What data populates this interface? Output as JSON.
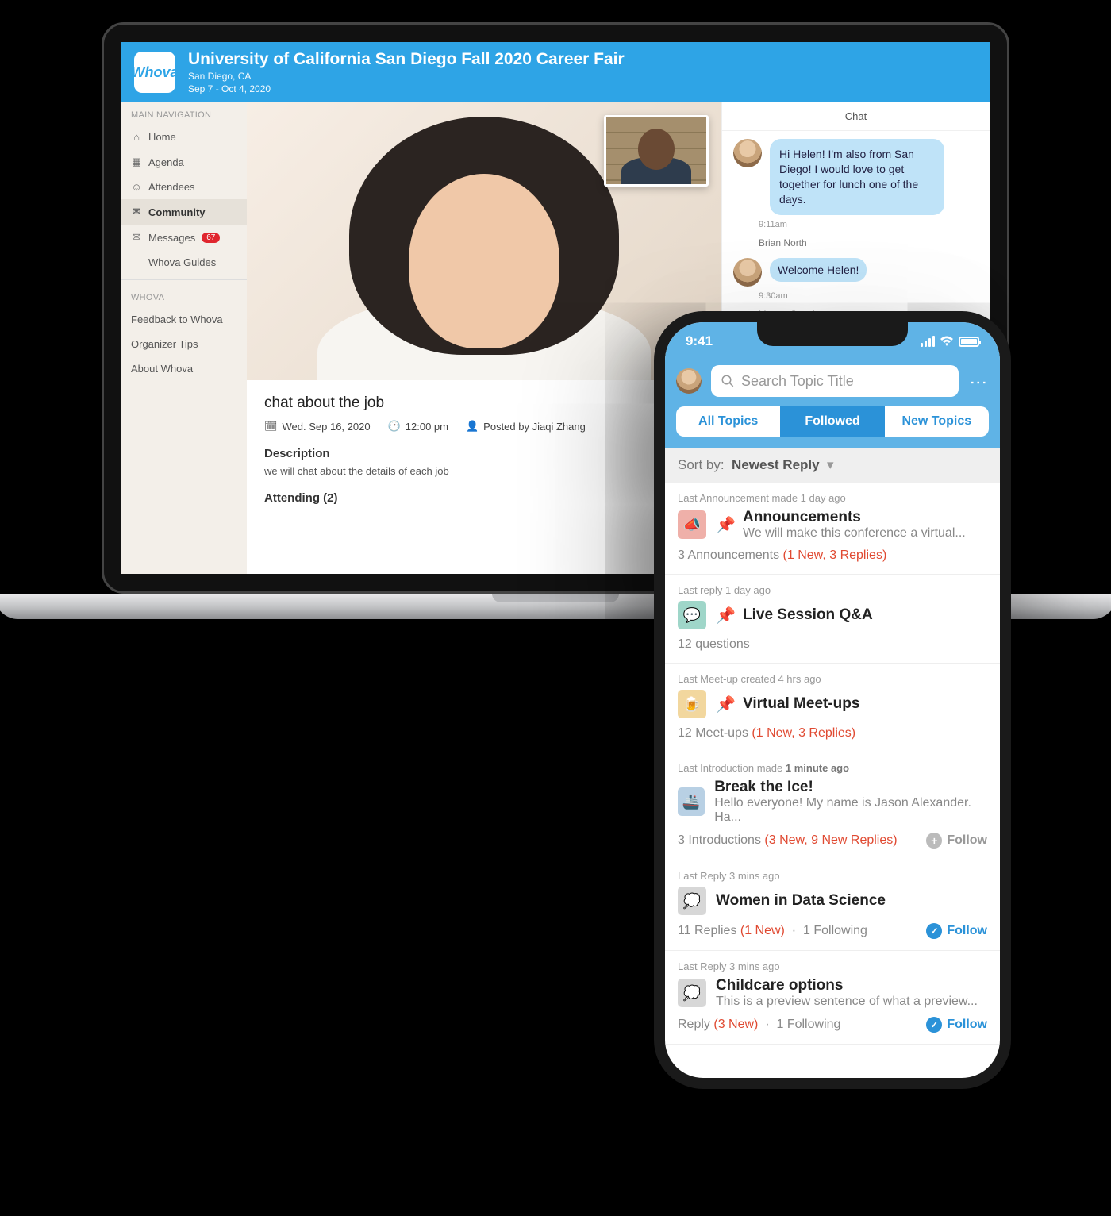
{
  "laptop": {
    "brand": "Whova",
    "event_title": "University of California San Diego Fall 2020 Career Fair",
    "event_location": "San Diego, CA",
    "event_dates": "Sep 7 - Oct 4, 2020",
    "nav": {
      "heading_main": "MAIN NAVIGATION",
      "home": "Home",
      "agenda": "Agenda",
      "attendees": "Attendees",
      "community": "Community",
      "messages": "Messages",
      "messages_badge": "67",
      "guides": "Whova Guides",
      "heading_whova": "WHOVA",
      "feedback": "Feedback to Whova",
      "tips": "Organizer Tips",
      "about": "About Whova"
    },
    "meeting": {
      "title": "chat about the job",
      "date": "Wed. Sep 16, 2020",
      "time": "12:00 pm",
      "posted_by": "Posted by Jiaqi Zhang",
      "desc_heading": "Description",
      "desc_text": "we will chat about the details of each job",
      "attending": "Attending (2)"
    },
    "chat": {
      "heading": "Chat",
      "msg1_text": "Hi Helen! I'm also from San Diego! I would love to get together for lunch one of the days.",
      "msg1_time": "9:11am",
      "msg2_name": "Brian North",
      "msg2_text": "Welcome Helen!",
      "msg2_time": "9:30am",
      "msg3_name": "Lianne Gowdy"
    }
  },
  "phone": {
    "status_time": "9:41",
    "search_placeholder": "Search Topic Title",
    "tabs": {
      "all": "All Topics",
      "followed": "Followed",
      "new": "New Topics"
    },
    "sort_label": "Sort by:",
    "sort_value": "Newest Reply",
    "topics": {
      "ann": {
        "when": "Last Announcement made 1 day ago",
        "title": "Announcements",
        "sub": "We will make this conference a virtual...",
        "stats": "3 Announcements",
        "stats_red": "(1 New, 3 Replies)"
      },
      "live": {
        "when": "Last reply 1 day ago",
        "title": "Live Session Q&A",
        "stats": "12 questions"
      },
      "meet": {
        "when": "Last Meet-up created 4 hrs ago",
        "title": "Virtual Meet-ups",
        "stats": "12 Meet-ups",
        "stats_red": "(1 New, 3 Replies)"
      },
      "ice": {
        "when_prefix": "Last Introduction made",
        "when_bold": "1 minute ago",
        "title": "Break the Ice!",
        "sub": "Hello everyone! My name is Jason Alexander. Ha...",
        "stats": "3 Introductions",
        "stats_red": "(3 New, 9 New Replies)",
        "follow": "Follow"
      },
      "women": {
        "when": "Last Reply 3 mins ago",
        "title": "Women in Data Science",
        "stats_a": "11 Replies",
        "stats_red": "(1 New)",
        "stats_b": "1 Following",
        "follow": "Follow"
      },
      "child": {
        "when": "Last Reply 3 mins ago",
        "title": "Childcare options",
        "sub": "This is a preview sentence of what a preview...",
        "stats_a": "Reply",
        "stats_red": "(3 New)",
        "stats_b": "1 Following",
        "follow": "Follow"
      }
    }
  }
}
